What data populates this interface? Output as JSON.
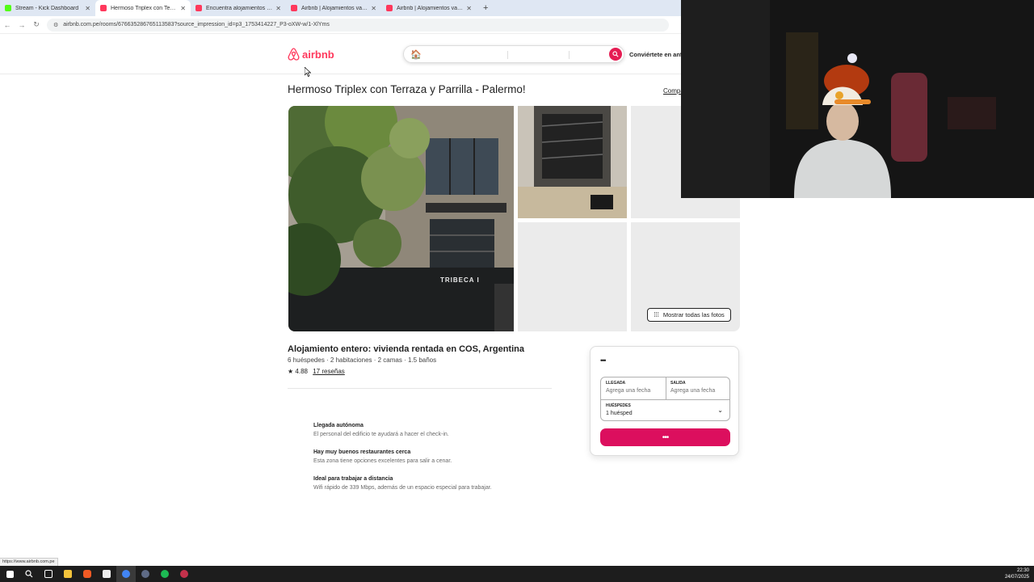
{
  "browser": {
    "tabs": [
      {
        "title": "Stream - Kick Dashboard",
        "favicon_color": "#53fc18",
        "active": false
      },
      {
        "title": "Hermoso Triplex con Terraza y Parrilla - Palermo! - Airbnb",
        "favicon_color": "#ff385c",
        "active": true
      },
      {
        "title": "Encuentra alojamientos en Lima",
        "favicon_color": "#ff385c",
        "active": false
      },
      {
        "title": "Airbnb | Alojamientos vacacionales",
        "favicon_color": "#ff385c",
        "active": false
      },
      {
        "title": "Airbnb | Alojamientos vacacionales",
        "favicon_color": "#ff385c",
        "active": false
      }
    ],
    "new_tab_label": "+",
    "url": "airbnb.com.pe/rooms/676635286765113583?source_impression_id=p3_1753414227_P3-oXW-w/1-XlYms",
    "status_url": "https://www.airbnb.com.pe"
  },
  "header": {
    "logo_text": "airbnb",
    "host_link": "Conviértete en anfitrión",
    "accent": "#ff385c"
  },
  "listing": {
    "title": "Hermoso Triplex con Terraza y Parrilla - Palermo!",
    "share_label": "Compartir",
    "show_all_photos": "Mostrar todas las fotos",
    "photo_sign_text": "TRIBECA I",
    "subtitle": "Alojamiento entero: vivienda rentada en COS, Argentina",
    "meta": "6 huéspedes · 2 habitaciones · 2 camas · 1.5 baños",
    "rating": "★ 4.88",
    "reviews_link": "17 reseñas",
    "highlights": [
      {
        "heading": "Llegada autónoma",
        "detail": "El personal del edificio te ayudará a hacer el check-in."
      },
      {
        "heading": "Hay muy buenos restaurantes cerca",
        "detail": "Esta zona tiene opciones excelentes para salir a cenar."
      },
      {
        "heading": "Ideal para trabajar a distancia",
        "detail": "Wifi rápido de 339 Mbps, además de un espacio especial para trabajar."
      }
    ]
  },
  "booking": {
    "loading_dots": "•••",
    "checkin_label": "LLEGADA",
    "checkin_value": "Agrega una fecha",
    "checkout_label": "SALIDA",
    "checkout_value": "Agrega una fecha",
    "guests_label": "HUÉSPEDES",
    "guests_value": "1 huésped",
    "reserve_dots": "•••",
    "button_color": "#dc0f5e"
  },
  "taskbar": {
    "time": "22:30",
    "date": "24/07/2025"
  }
}
